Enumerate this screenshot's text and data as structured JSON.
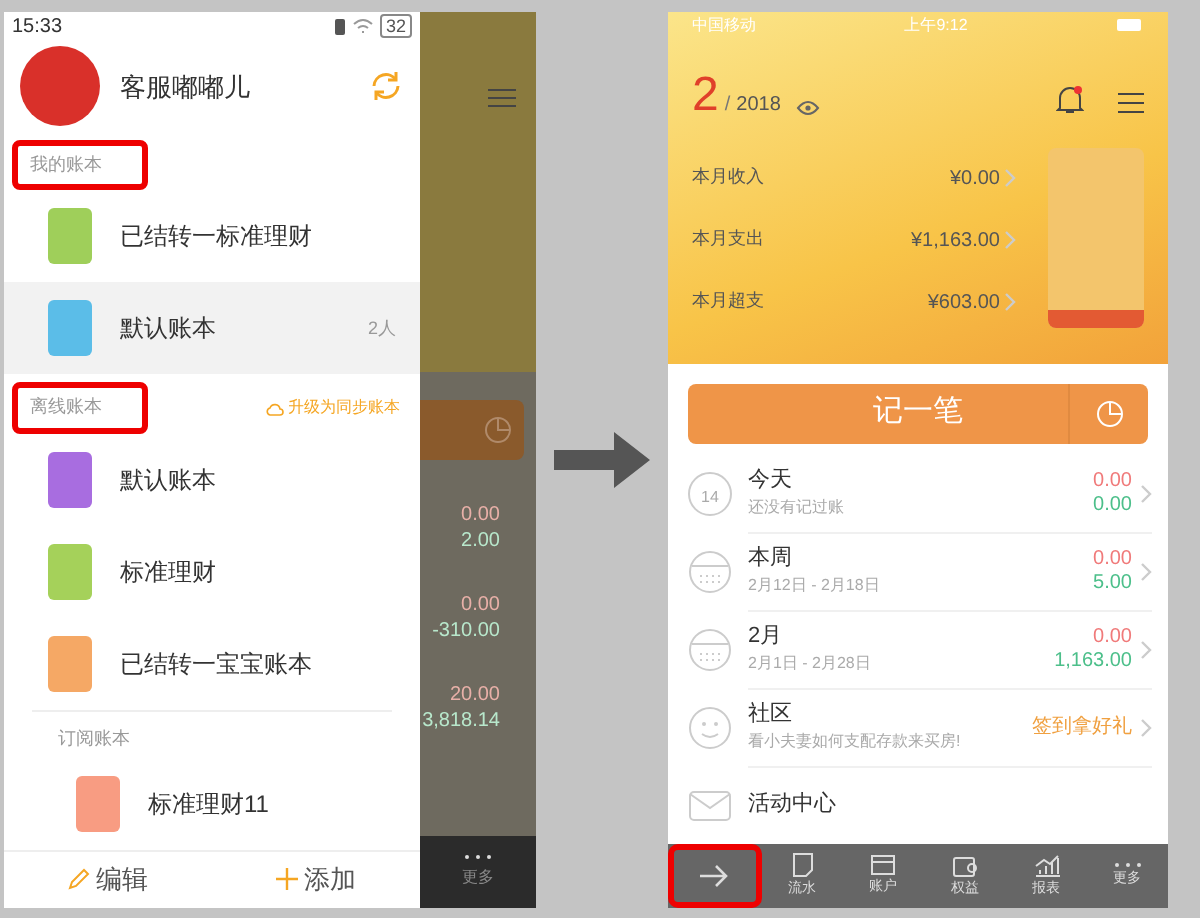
{
  "left_screen": {
    "status_bar": {
      "time": "15:33",
      "battery": "32"
    },
    "profile": {
      "name": "客服嘟嘟儿"
    },
    "sections": [
      {
        "title": "我的账本",
        "highlighted": true,
        "books": [
          {
            "name": "已结转一标准理财",
            "color": "#9fcf5a",
            "selected": false
          },
          {
            "name": "默认账本",
            "color": "#5bbde8",
            "selected": true,
            "badge": "2人"
          }
        ]
      },
      {
        "title": "离线账本",
        "highlighted": true,
        "action": "升级为同步账本",
        "books": [
          {
            "name": "默认账本",
            "color": "#a86de0",
            "selected": false
          },
          {
            "name": "标准理财",
            "color": "#a5d15a",
            "selected": false
          },
          {
            "name": "已结转一宝宝账本",
            "color": "#f5a865",
            "selected": false
          }
        ]
      },
      {
        "title": "订阅账本",
        "highlighted": false,
        "books": [
          {
            "name": "标准理财11",
            "color": "#f89c82",
            "selected": false
          }
        ]
      }
    ],
    "footer": [
      {
        "kind": "edit",
        "label": "编辑"
      },
      {
        "kind": "add",
        "label": "添加"
      }
    ],
    "behind": {
      "rows": [
        {
          "income": "0.00",
          "balance": "2.00"
        },
        {
          "income": "0.00",
          "balance": "-310.00"
        },
        {
          "income": "20.00",
          "balance": "3,818.14"
        }
      ],
      "tab_label": "更多"
    }
  },
  "right_screen": {
    "status_bar": {
      "carrier": "中国移动",
      "time": "上午9:12"
    },
    "month": "2",
    "separator": "/",
    "year": "2018",
    "summary": [
      {
        "label": "本月收入",
        "amount": "¥0.00"
      },
      {
        "label": "本月支出",
        "amount": "¥1,163.00"
      },
      {
        "label": "本月超支",
        "amount": "¥603.00"
      }
    ],
    "budget_meter": {
      "level": 0.1
    },
    "record_button": "记一笔",
    "list": [
      {
        "kind": "day",
        "icon_text": "14",
        "title": "今天",
        "subtitle": "还没有记过账",
        "income": "0.00",
        "expense": "0.00"
      },
      {
        "kind": "week",
        "title": "本周",
        "subtitle": "2月12日 - 2月18日",
        "income": "0.00",
        "expense": "5.00"
      },
      {
        "kind": "month",
        "title": "2月",
        "subtitle": "2月1日 - 2月28日",
        "income": "0.00",
        "expense": "1,163.00"
      },
      {
        "kind": "community",
        "title": "社区",
        "subtitle": "看小夫妻如何支配存款来买房!",
        "promo": "签到拿好礼"
      },
      {
        "kind": "mail",
        "title": "活动中心"
      }
    ],
    "tabs": [
      {
        "kind": "back",
        "highlighted": true
      },
      {
        "kind": "flow",
        "label": "流水",
        "highlighted": false
      },
      {
        "kind": "account",
        "label": "账户",
        "highlighted": false
      },
      {
        "kind": "wallet",
        "label": "权益",
        "highlighted": false
      },
      {
        "kind": "report",
        "label": "报表",
        "highlighted": false
      },
      {
        "kind": "more",
        "label": "更多",
        "highlighted": false
      }
    ]
  }
}
